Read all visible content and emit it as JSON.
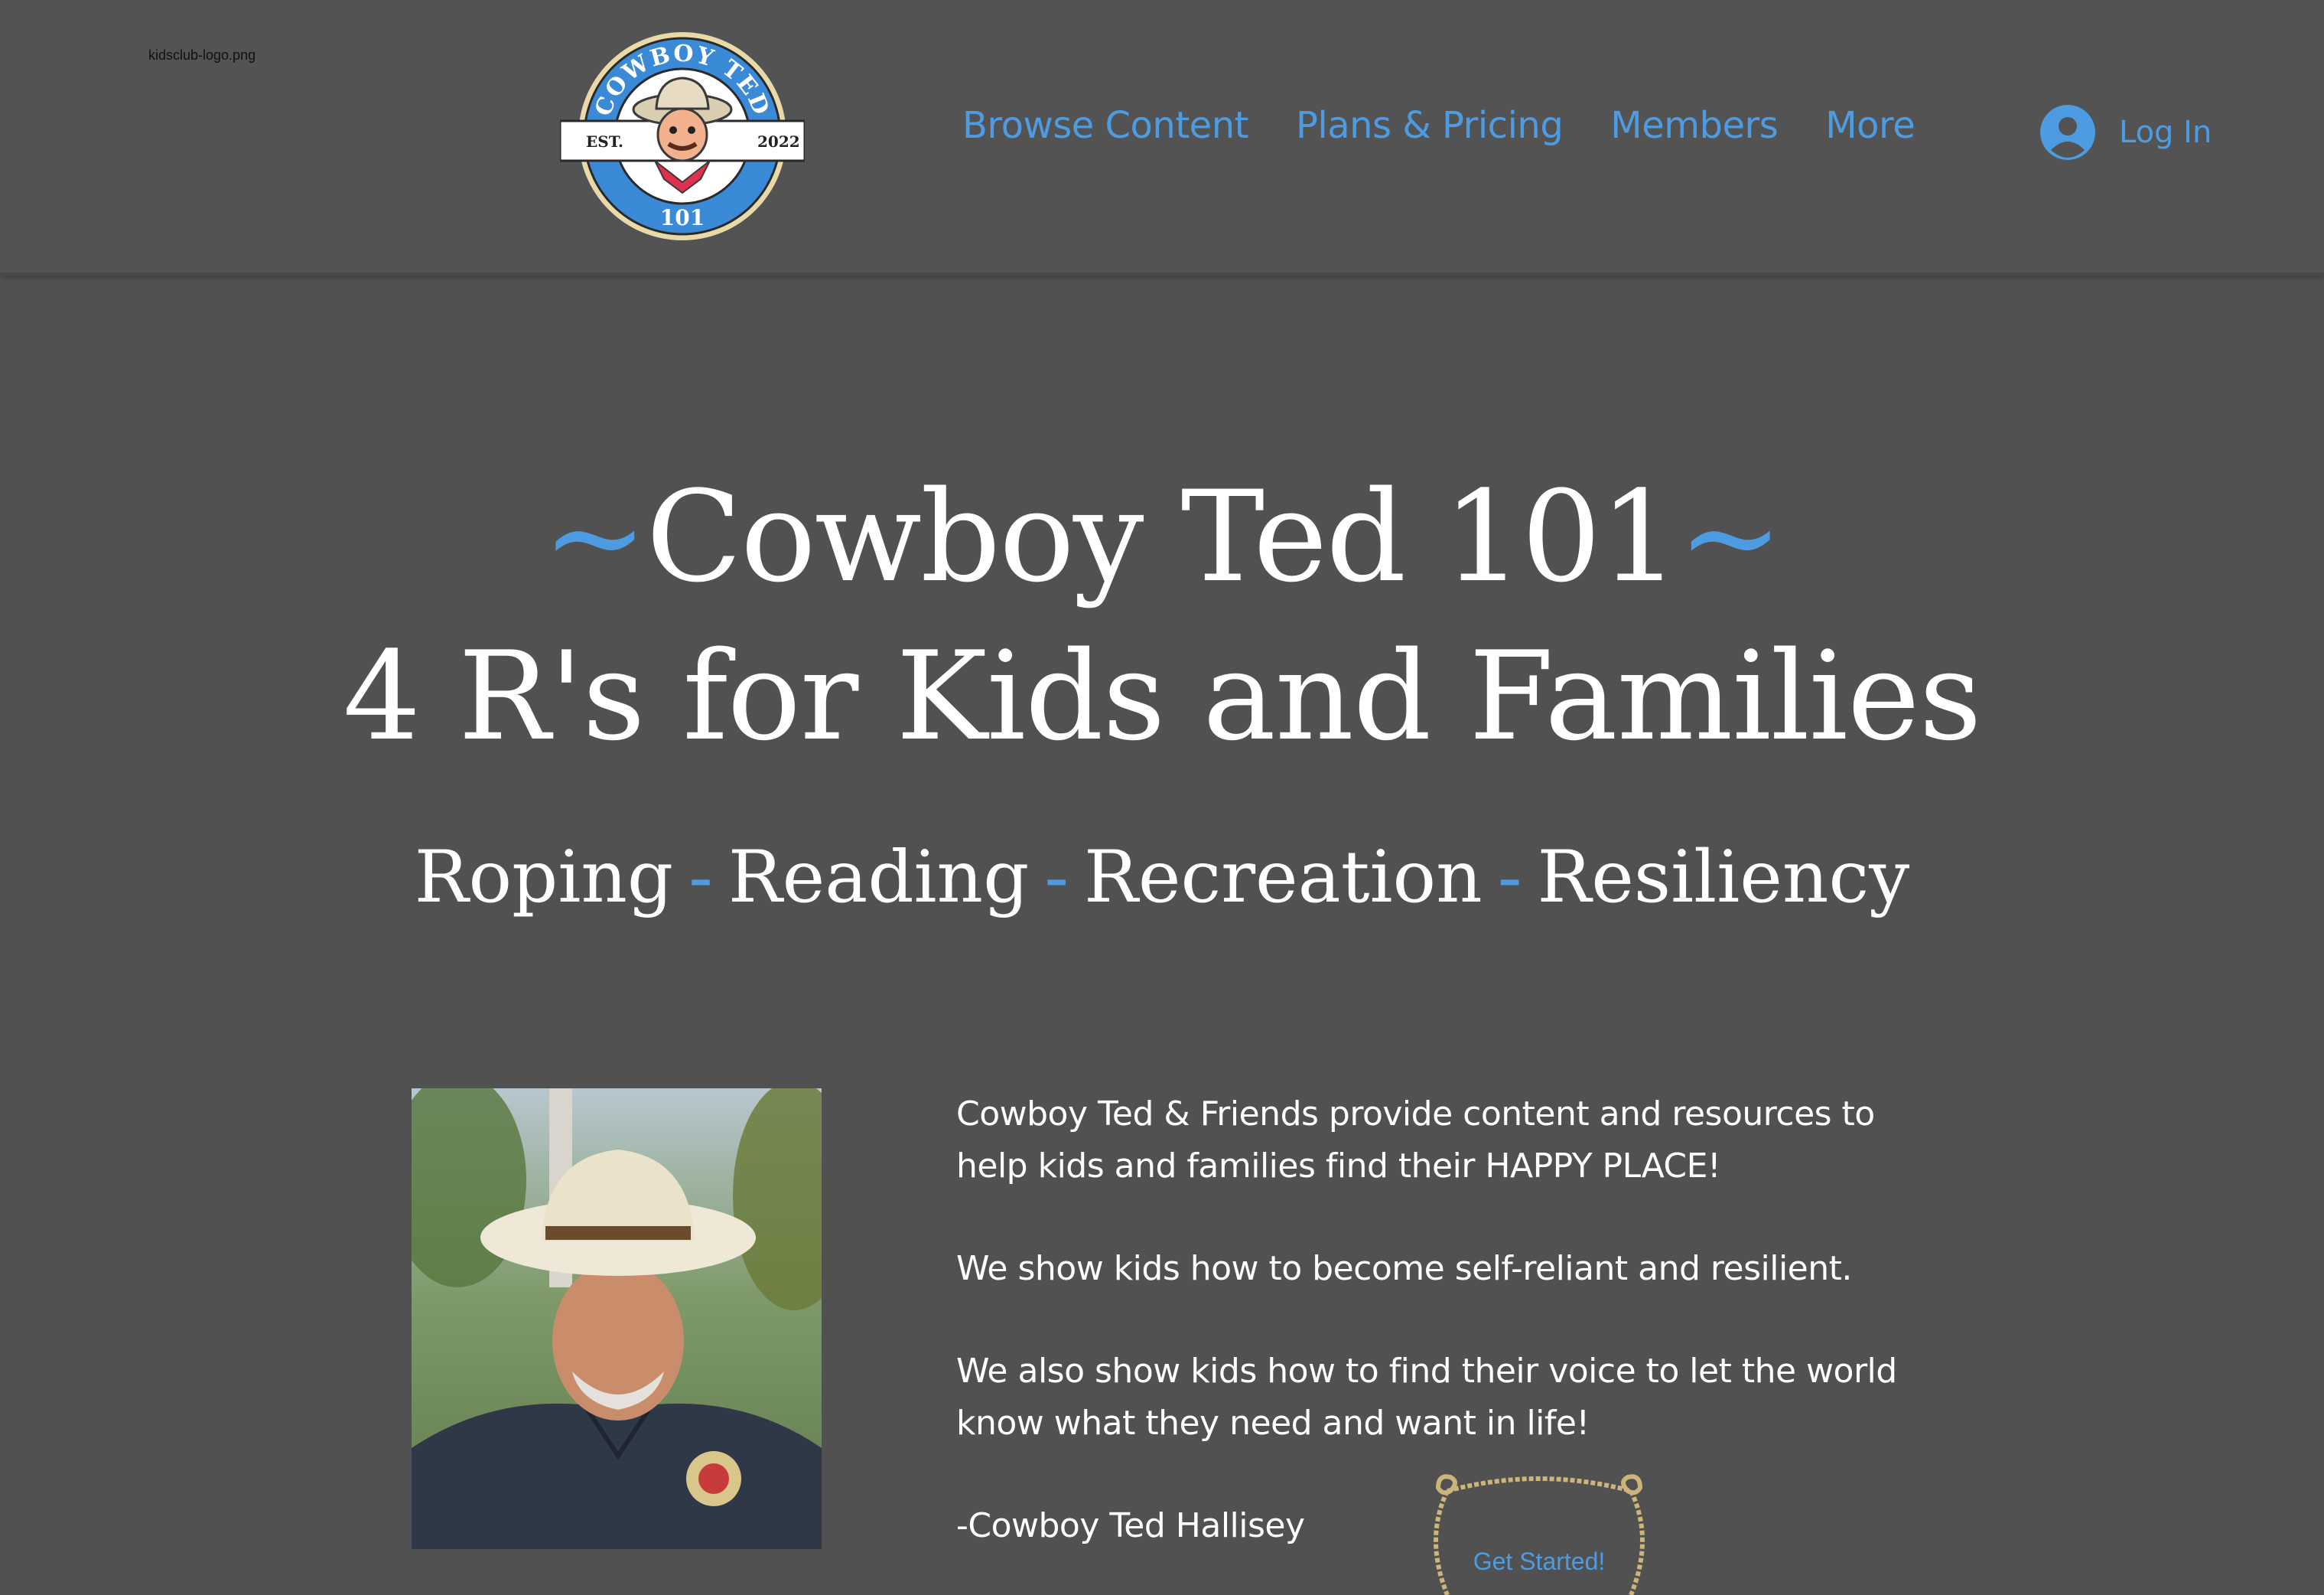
{
  "header": {
    "logo_alt": "kidsclub-logo.png",
    "logo": {
      "arc_text": "COWBOY TED",
      "est_label": "EST.",
      "year": "2022",
      "number": "101"
    },
    "nav": [
      {
        "label": "Browse Content"
      },
      {
        "label": "Plans & Pricing"
      },
      {
        "label": "Members"
      },
      {
        "label": "More"
      }
    ],
    "login_label": "Log In",
    "login_icon": "user-avatar-icon"
  },
  "hero": {
    "tilde_left": "~",
    "title": "Cowboy Ted 101",
    "tilde_right": "~",
    "subtitle": "4 R's for Kids and Families",
    "rs": [
      "Roping",
      "Reading",
      "Recreation",
      "Resiliency"
    ],
    "separator": "-"
  },
  "about": {
    "paragraphs": [
      "Cowboy Ted & Friends provide content and resources to help kids and families find their HAPPY PLACE!",
      "We show kids how to become self-reliant and resilient.",
      "We also show kids how to find their voice to let the world know what they need and want in life!"
    ],
    "signature": "-Cowboy Ted Hallisey"
  },
  "cta": {
    "label": "Get Started!"
  },
  "colors": {
    "background": "#515151",
    "accent": "#4d9be0",
    "text": "#ffffff"
  }
}
